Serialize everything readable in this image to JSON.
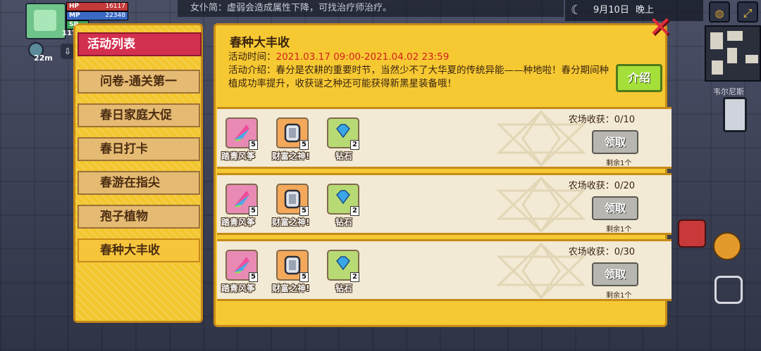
{
  "hud": {
    "hp_label": "HP",
    "hp_value": "16117",
    "mp_label": "MP",
    "mp_value": "22348",
    "sp_label": "SP",
    "level": "117",
    "timer": "22m",
    "ticker_text": "女仆简：虚弱会造成属性下降，可找治疗师治疗。",
    "date_text": "9月10日",
    "time_of_day": "晚上",
    "minimap_label": "韦尔尼斯"
  },
  "sidebar": {
    "tabs": [
      {
        "label": "活动列表"
      },
      {
        "label": "问卷-通关第一"
      },
      {
        "label": "春日家庭大促"
      },
      {
        "label": "春日打卡"
      },
      {
        "label": "春游在指尖"
      },
      {
        "label": "孢子植物"
      },
      {
        "label": "春种大丰收"
      }
    ]
  },
  "panel": {
    "title": "春种大丰收",
    "time_label": "活动时间：",
    "time_value": "2021.03.17 09:00-2021.04.02 23:59",
    "intro_label": "活动介绍：",
    "intro_text": "春分是农耕的重要时节，当然少不了大华夏的传统异能——种地啦！春分期间种植成功率提升，收获谜之种还可能获得新黑星装备哦！",
    "intro_button": "介绍",
    "close_icon": "✕",
    "rewards": [
      {
        "progress": "农场收获：0/10",
        "claim": "领取",
        "remaining": "剩余1个",
        "items": [
          {
            "name": "踏青风筝",
            "qty": "5"
          },
          {
            "name": "财富之神!",
            "qty": "5"
          },
          {
            "name": "钻石",
            "qty": "2"
          }
        ]
      },
      {
        "progress": "农场收获：0/20",
        "claim": "领取",
        "remaining": "剩余1个",
        "items": [
          {
            "name": "踏青风筝",
            "qty": "5"
          },
          {
            "name": "财富之神!",
            "qty": "5"
          },
          {
            "name": "钻石",
            "qty": "2"
          }
        ]
      },
      {
        "progress": "农场收获：0/30",
        "claim": "领取",
        "remaining": "剩余1个",
        "items": [
          {
            "name": "踏青风筝",
            "qty": "5"
          },
          {
            "name": "财富之神!",
            "qty": "5"
          },
          {
            "name": "钻石",
            "qty": "2"
          }
        ]
      }
    ]
  },
  "colors": {
    "accent": "#f6c933",
    "tab_active": "#d33050",
    "time_red": "#d21e1e",
    "intro_green": "#a5e03a"
  }
}
